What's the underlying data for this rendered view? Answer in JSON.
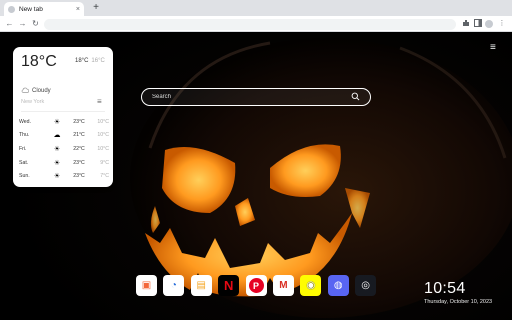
{
  "browser": {
    "tab_title": "New tab",
    "tab_close": "×",
    "new_tab": "+",
    "back": "←",
    "forward": "→",
    "reload": "↻",
    "extensions_icon": "extensions-icon",
    "menu_icon": "kebab-menu-icon"
  },
  "weather": {
    "temp": "18°C",
    "high": "18°C",
    "low": "16°C",
    "condition": "Cloudy",
    "city": "New York",
    "forecast": [
      {
        "day": "Wed.",
        "icon": "sun-icon",
        "high": "23°C",
        "low": "10°C"
      },
      {
        "day": "Thu.",
        "icon": "cloud-icon",
        "high": "21°C",
        "low": "10°C"
      },
      {
        "day": "Fri.",
        "icon": "sun-icon",
        "high": "22°C",
        "low": "10°C"
      },
      {
        "day": "Sat.",
        "icon": "sun-icon",
        "high": "23°C",
        "low": "9°C"
      },
      {
        "day": "Sun.",
        "icon": "sun-icon",
        "high": "23°C",
        "low": "7°C"
      }
    ]
  },
  "search": {
    "placeholder": "Search"
  },
  "dock": {
    "apps": [
      {
        "name": "photos",
        "glyph": "▣",
        "color": "#f4683b"
      },
      {
        "name": "speed",
        "glyph": "◔",
        "color": "#2a6fdb"
      },
      {
        "name": "notes",
        "glyph": "▤",
        "color": "#f5a623"
      },
      {
        "name": "netflix",
        "glyph": "N",
        "color": "#e50914"
      },
      {
        "name": "pinterest",
        "glyph": "P",
        "color": "#e60023"
      },
      {
        "name": "gmail",
        "glyph": "M",
        "color": "#d93025"
      },
      {
        "name": "snapchat",
        "glyph": "◉",
        "color": "#fffc00"
      },
      {
        "name": "discord",
        "glyph": "◍",
        "color": "#5865f2"
      },
      {
        "name": "steam",
        "glyph": "◎",
        "color": "#171a21"
      }
    ]
  },
  "clock": {
    "time": "10:54",
    "date": "Thursday, October 10, 2023"
  }
}
